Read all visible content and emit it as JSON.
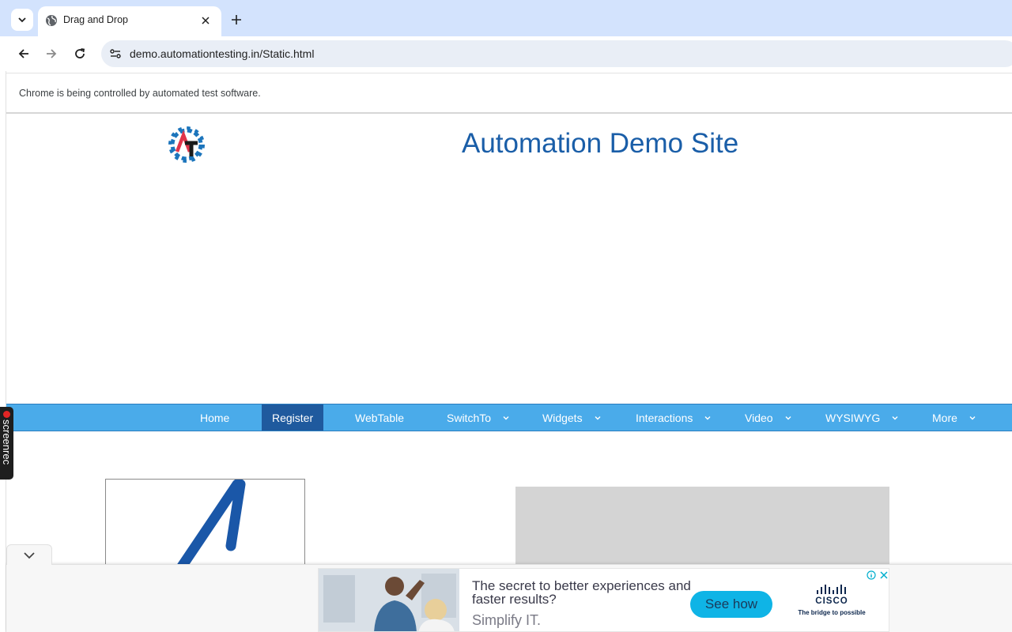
{
  "browser": {
    "tab_title": "Drag and Drop",
    "url": "demo.automationtesting.in/Static.html",
    "infobar_text": "Chrome is being controlled by automated test software."
  },
  "page": {
    "site_title": "Automation Demo Site",
    "logo_letters": "AT",
    "nav": [
      {
        "label": "Home",
        "active": false,
        "dropdown": false
      },
      {
        "label": "Register",
        "active": true,
        "dropdown": false
      },
      {
        "label": "WebTable",
        "active": false,
        "dropdown": false
      },
      {
        "label": "SwitchTo",
        "active": false,
        "dropdown": true
      },
      {
        "label": "Widgets",
        "active": false,
        "dropdown": true
      },
      {
        "label": "Interactions",
        "active": false,
        "dropdown": true
      },
      {
        "label": "Video",
        "active": false,
        "dropdown": true
      },
      {
        "label": "WYSIWYG",
        "active": false,
        "dropdown": true
      },
      {
        "label": "More",
        "active": false,
        "dropdown": true
      }
    ]
  },
  "screenrec": {
    "label": "screenrec"
  },
  "ad": {
    "headline": "The secret to better experiences and faster results?",
    "sub": "Simplify IT.",
    "cta": "See how",
    "brand": "CISCO",
    "tagline": "The bridge to possible"
  },
  "colors": {
    "navbar": "#4aabea",
    "nav_active": "#1f5a9e",
    "title": "#1a5ea8",
    "cta": "#0fb4e6"
  }
}
